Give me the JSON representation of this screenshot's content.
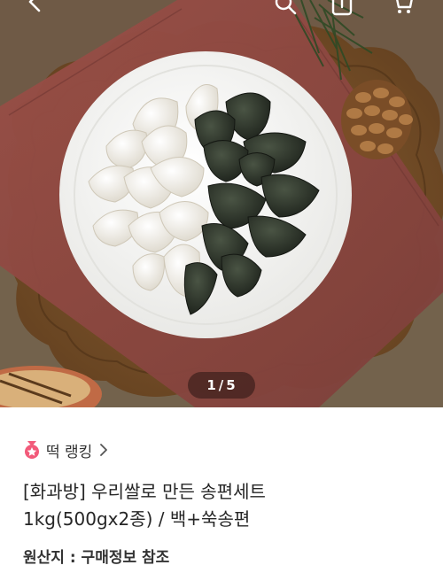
{
  "gallery": {
    "current": "1",
    "separator": "/",
    "total": "5"
  },
  "product": {
    "ranking_label": "떡 랭킹",
    "title_line1": "[화과방] 우리쌀로 만든 송편세트",
    "title_line2": "1kg(500gx2종) / 백+쑥송편",
    "origin": "원산지 : 구매정보 참조"
  },
  "icons": {
    "back": "back-arrow-icon",
    "search": "search-icon",
    "share": "share-icon",
    "cart": "cart-icon",
    "medal": "medal-icon",
    "chevron": "chevron-right-icon"
  },
  "colors": {
    "medal": "#f25a7a",
    "table": "#7b5128",
    "runner": "#8a4a43",
    "plate": "#f4f4f2",
    "rice_cake_white": "#f1eee6",
    "rice_cake_green": "#2a3027"
  }
}
